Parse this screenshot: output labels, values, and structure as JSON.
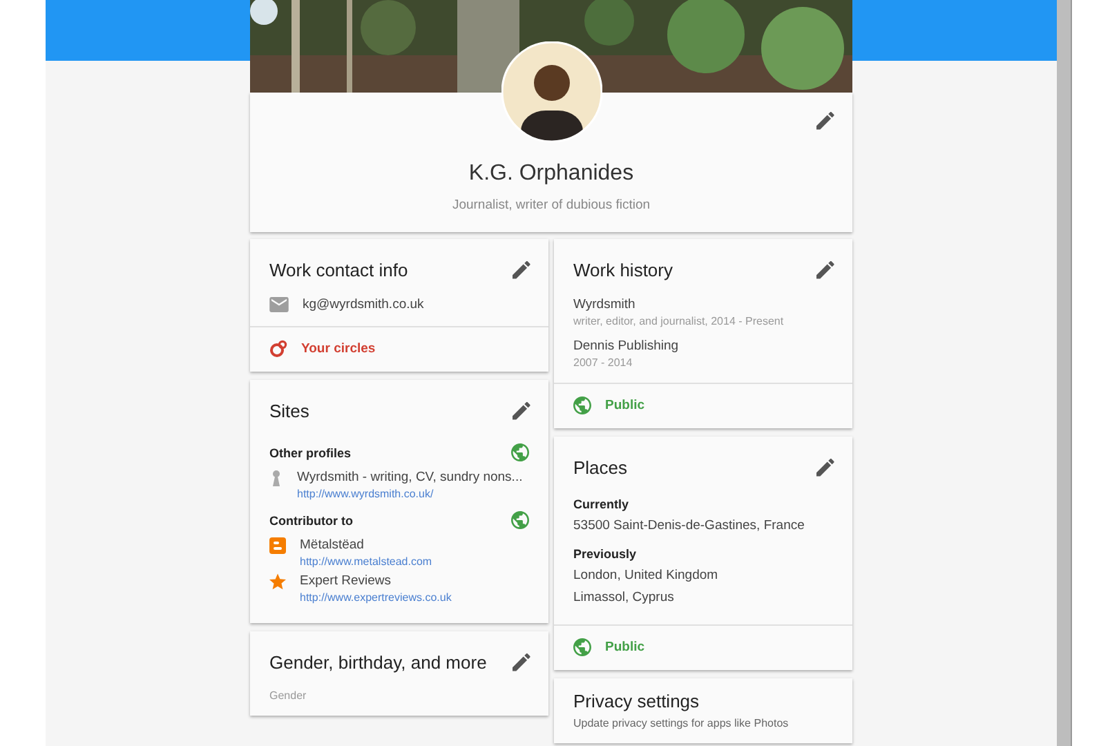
{
  "profile": {
    "name": "K.G. Orphanides",
    "tagline": "Journalist, writer of dubious fiction",
    "editable": true
  },
  "left_column": [
    {
      "kind": "contact",
      "title": "Work contact info",
      "editable": true,
      "items": [
        {
          "kind": "email",
          "text": "kg@wyrdsmith.co.uk"
        }
      ],
      "footer": {
        "kind": "circles",
        "label": "Your circles"
      }
    },
    {
      "kind": "sites",
      "title": "Sites",
      "editable": true,
      "groups": [
        {
          "heading": "Other profiles",
          "public": true,
          "links": [
            {
              "kind": "profile",
              "title": "Wyrdsmith - writing, CV, sundry nons...",
              "url": "http://www.wyrdsmith.co.uk/"
            }
          ]
        },
        {
          "heading": "Contributor to",
          "public": true,
          "links": [
            {
              "kind": "blog",
              "title": "Mëtalstëad",
              "url": "http://www.metalstead.com"
            },
            {
              "kind": "review",
              "title": "Expert Reviews",
              "url": "http://www.expertreviews.co.uk"
            }
          ]
        }
      ]
    },
    {
      "kind": "fields",
      "title": "Gender, birthday, and more",
      "editable": true,
      "fields": [
        {
          "label": "Gender"
        }
      ]
    }
  ],
  "right_column": [
    {
      "kind": "history",
      "title": "Work history",
      "editable": true,
      "entries": [
        {
          "name": "Wyrdsmith",
          "detail": "writer, editor, and journalist, 2014 - Present"
        },
        {
          "name": "Dennis Publishing",
          "detail": "2007 - 2014"
        }
      ],
      "footer": {
        "kind": "public",
        "label": "Public"
      }
    },
    {
      "kind": "places",
      "title": "Places",
      "editable": true,
      "groups": [
        {
          "heading": "Currently",
          "lines": [
            "53500 Saint-Denis-de-Gastines, France"
          ]
        },
        {
          "heading": "Previously",
          "lines": [
            "London, United Kingdom",
            "Limassol, Cyprus"
          ]
        }
      ],
      "footer": {
        "kind": "public",
        "label": "Public"
      }
    },
    {
      "kind": "text",
      "title": "Privacy settings",
      "editable": false,
      "text": "Update privacy settings for apps like Photos"
    }
  ]
}
